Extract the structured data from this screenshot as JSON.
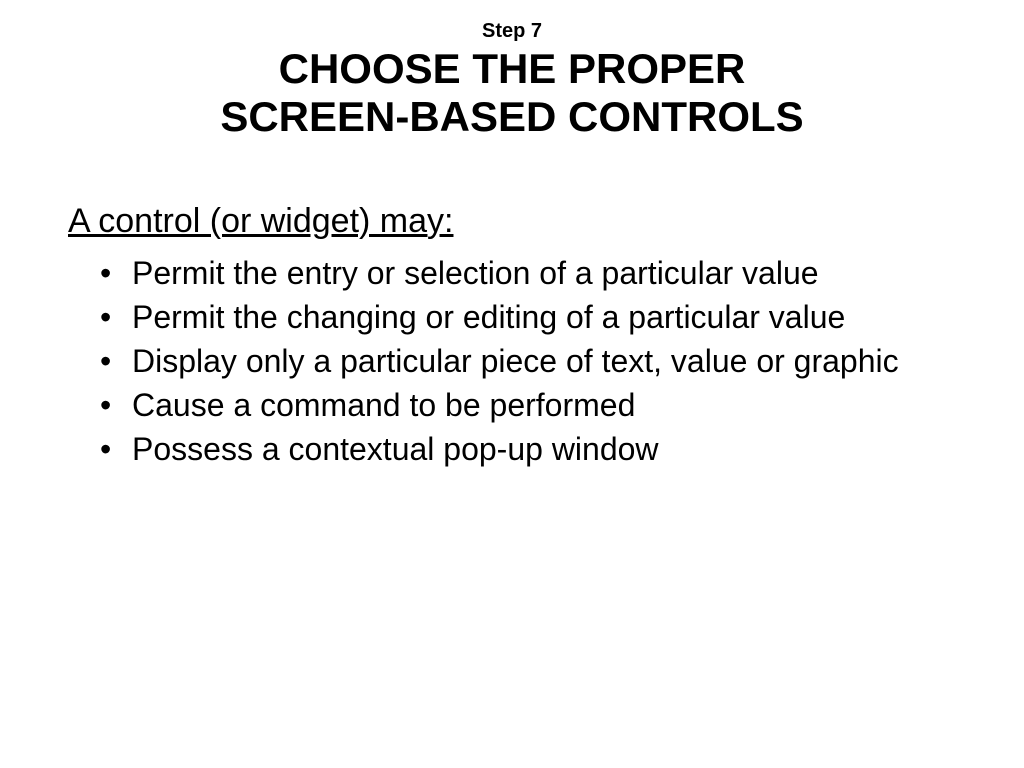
{
  "header": {
    "step_label": "Step 7",
    "title_line1": "CHOOSE THE PROPER",
    "title_line2": "SCREEN-BASED CONTROLS"
  },
  "content": {
    "subheading": "A control (or widget) may:",
    "bullets": [
      "Permit the entry or selection of a particular value",
      "Permit the changing or editing of a particular value",
      "Display only a particular piece of text, value or graphic",
      "Cause a command to be performed",
      "Possess a contextual pop-up window"
    ]
  }
}
